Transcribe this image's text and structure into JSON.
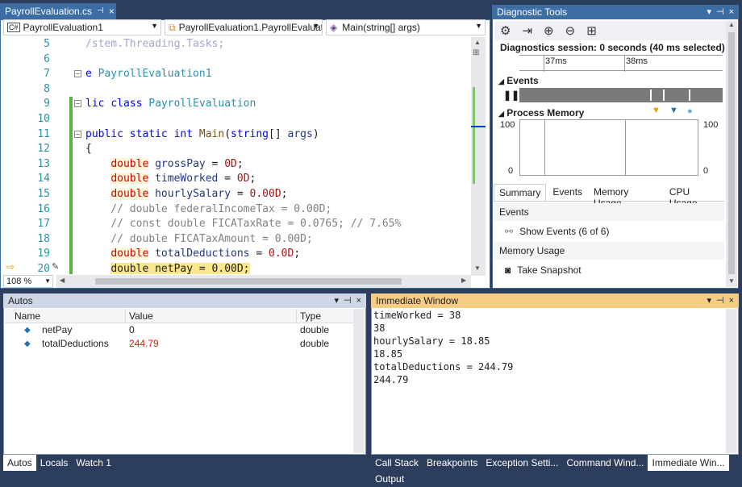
{
  "editor": {
    "tab_title": "PayrollEvaluation.cs",
    "tab_pin": "⊞",
    "tab_close": "×",
    "combo_project": "PayrollEvaluation1",
    "combo_project_prefix": "C#",
    "combo_class": "PayrollEvaluation1.PayrollEvaluati",
    "combo_member": "Main(string[] args)",
    "zoom": "108 %",
    "lines": [
      {
        "n": "5",
        "text": "/stem.Threading.Tasks;",
        "style": "cmt-blue"
      },
      {
        "n": "6",
        "text": "",
        "style": ""
      },
      {
        "n": "7",
        "text": "e PayrollEvaluation1",
        "style": "ns"
      },
      {
        "n": "8",
        "text": "",
        "style": ""
      },
      {
        "n": "9",
        "text": "lic class PayrollEvaluation",
        "style": "cls"
      },
      {
        "n": "10",
        "text": "",
        "style": ""
      },
      {
        "n": "11",
        "text": "public static int Main(string[] args)",
        "style": "sig"
      },
      {
        "n": "12",
        "text": "{",
        "style": ""
      },
      {
        "n": "13",
        "text": "    double grossPay = 0D;",
        "style": "decl"
      },
      {
        "n": "14",
        "text": "    double timeWorked = 0D;",
        "style": "decl"
      },
      {
        "n": "15",
        "text": "    double hourlySalary = 0.00D;",
        "style": "decl"
      },
      {
        "n": "16",
        "text": "    // double federalIncomeTax = 0.00D;",
        "style": "cmt"
      },
      {
        "n": "17",
        "text": "    // const double FICATaxRate = 0.0765; // 7.65%",
        "style": "cmt"
      },
      {
        "n": "18",
        "text": "    // double FICATaxAmount = 0.00D;",
        "style": "cmt"
      },
      {
        "n": "19",
        "text": "    double totalDeductions = 0.0D;",
        "style": "decl"
      },
      {
        "n": "20",
        "text": "    double netPay = 0.00D;",
        "style": "current"
      }
    ]
  },
  "diagnostics": {
    "title": "Diagnostic Tools",
    "session": "Diagnostics session: 0 seconds (40 ms selected)",
    "tick1": "37ms",
    "tick2": "38ms",
    "events_label": "Events",
    "memory_label": "Process Memory",
    "mem_max_left": "100",
    "mem_min_left": "0",
    "mem_max_right": "100",
    "mem_min_right": "0",
    "tabs": [
      "Summary",
      "Events",
      "Memory Usage",
      "CPU Usage"
    ],
    "section_events": "Events",
    "show_events": "Show Events (6 of 6)",
    "section_memory": "Memory Usage",
    "take_snapshot": "Take Snapshot",
    "cpu_partial": "CPU U..."
  },
  "autos": {
    "title": "Autos",
    "columns": [
      "Name",
      "Value",
      "Type"
    ],
    "rows": [
      {
        "name": "netPay",
        "value": "0",
        "type": "double",
        "changed": false
      },
      {
        "name": "totalDeductions",
        "value": "244.79",
        "type": "double",
        "changed": true
      }
    ],
    "tabs": [
      "Autos",
      "Locals",
      "Watch 1"
    ]
  },
  "immediate": {
    "title": "Immediate Window",
    "lines": [
      "timeWorked = 38",
      "38",
      "hourlySalary = 18.85",
      "18.85",
      "totalDeductions = 244.79",
      "244.79"
    ],
    "tabs": [
      "Call Stack",
      "Breakpoints",
      "Exception Setti...",
      "Command Wind...",
      "Immediate Win...",
      "Output"
    ]
  },
  "colors": {
    "accent": "#3c6ea5",
    "active_header": "#f5cc84",
    "changed_value": "#e51400"
  }
}
